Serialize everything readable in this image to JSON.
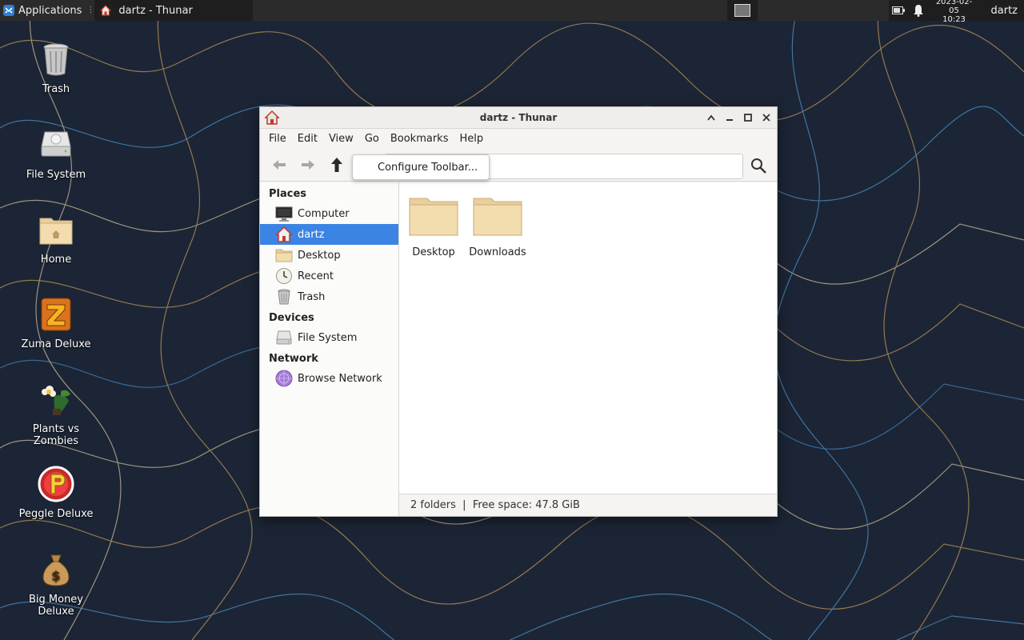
{
  "panel": {
    "applications_label": "Applications",
    "task_title": "dartz - Thunar",
    "clock_date": "2023-02-05",
    "clock_time": "10:23",
    "user": "dartz"
  },
  "desktop_icons": [
    {
      "label": "Trash",
      "icon": "trash-icon"
    },
    {
      "label": "File System",
      "icon": "drive-icon"
    },
    {
      "label": "Home",
      "icon": "home-folder-icon"
    },
    {
      "label": "Zuma Deluxe",
      "icon": "zuma-icon"
    },
    {
      "label": "Plants vs Zombies",
      "icon": "plants-icon"
    },
    {
      "label": "Peggle Deluxe",
      "icon": "peggle-icon"
    },
    {
      "label": "Big Money Deluxe",
      "icon": "money-bag-icon"
    }
  ],
  "window": {
    "title": "dartz - Thunar",
    "menu": [
      "File",
      "Edit",
      "View",
      "Go",
      "Bookmarks",
      "Help"
    ],
    "context_popup": "Configure Toolbar...",
    "sidebar": {
      "places_header": "Places",
      "places": [
        {
          "label": "Computer",
          "icon": "monitor-icon"
        },
        {
          "label": "dartz",
          "icon": "home-icon",
          "active": true
        },
        {
          "label": "Desktop",
          "icon": "folder-icon"
        },
        {
          "label": "Recent",
          "icon": "clock-icon"
        },
        {
          "label": "Trash",
          "icon": "trash-icon"
        }
      ],
      "devices_header": "Devices",
      "devices": [
        {
          "label": "File System",
          "icon": "drive-icon"
        }
      ],
      "network_header": "Network",
      "network": [
        {
          "label": "Browse Network",
          "icon": "network-icon"
        }
      ]
    },
    "folders": [
      {
        "label": "Desktop"
      },
      {
        "label": "Downloads"
      }
    ],
    "status": "2 folders  |  Free space: 47.8 GiB"
  },
  "colors": {
    "selection": "#3b84e3",
    "panel_bg": "#2b2b2b",
    "folder_body": "#f3dcae"
  }
}
